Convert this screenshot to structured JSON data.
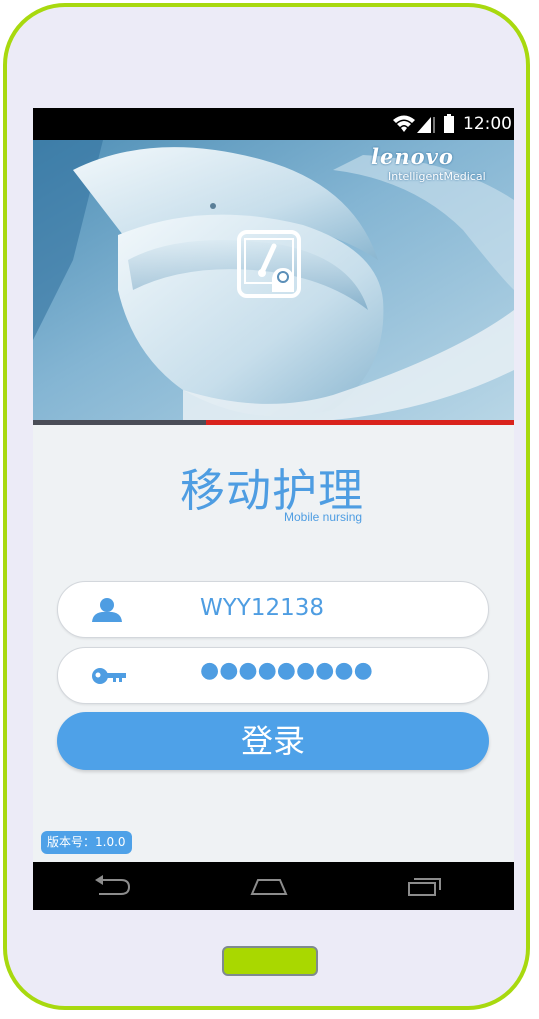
{
  "status_bar": {
    "time": "12:00",
    "icons": [
      "wifi-icon",
      "signal-icon",
      "battery-icon"
    ]
  },
  "brand": {
    "name": "lenovo",
    "subtitle": "IntelligentMedical"
  },
  "progress": {
    "fraction": 0.36
  },
  "app": {
    "title": "移动护理",
    "subtitle": "Mobile nursing"
  },
  "login": {
    "username": "WYY12138",
    "password_masked": "●●●●●●●●●",
    "button_label": "登录"
  },
  "version_label": "版本号：1.0.0",
  "colors": {
    "accent": "#4ea1e8",
    "frame": "#a8d90f",
    "progress_active": "#4a4d57",
    "progress_rest": "#d9231d"
  }
}
